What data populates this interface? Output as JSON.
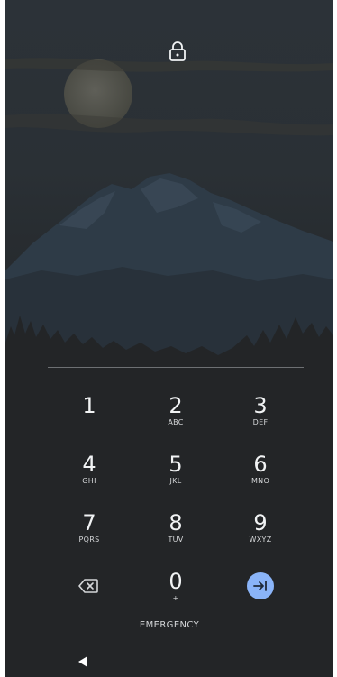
{
  "keypad": {
    "keys": [
      {
        "digit": "1",
        "letters": ""
      },
      {
        "digit": "2",
        "letters": "ABC"
      },
      {
        "digit": "3",
        "letters": "DEF"
      },
      {
        "digit": "4",
        "letters": "GHI"
      },
      {
        "digit": "5",
        "letters": "JKL"
      },
      {
        "digit": "6",
        "letters": "MNO"
      },
      {
        "digit": "7",
        "letters": "PQRS"
      },
      {
        "digit": "8",
        "letters": "TUV"
      },
      {
        "digit": "9",
        "letters": "WXYZ"
      },
      {
        "digit": "0",
        "letters": "+"
      }
    ],
    "emergency_label": "EMERGENCY"
  },
  "icons": {
    "lock": "lock-icon",
    "backspace": "backspace-icon",
    "enter": "enter-arrow-icon",
    "back": "back-triangle-icon"
  },
  "colors": {
    "background": "#232527",
    "accent": "#8ab4f8",
    "text": "#f1f3f4"
  }
}
